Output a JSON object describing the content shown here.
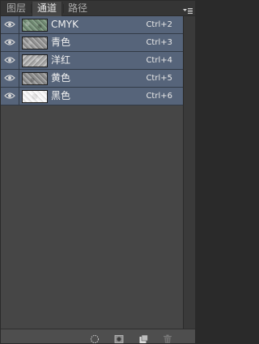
{
  "tabs": [
    {
      "label": "图层",
      "active": false
    },
    {
      "label": "通道",
      "active": true
    },
    {
      "label": "路径",
      "active": false
    }
  ],
  "panel_menu_icon": "panel-menu-icon",
  "channels": [
    {
      "name": "CMYK",
      "shortcut": "Ctrl+2",
      "visible": true,
      "thumb": "composite"
    },
    {
      "name": "青色",
      "shortcut": "Ctrl+3",
      "visible": true,
      "thumb": "gray"
    },
    {
      "name": "洋红",
      "shortcut": "Ctrl+4",
      "visible": true,
      "thumb": "gray"
    },
    {
      "name": "黄色",
      "shortcut": "Ctrl+5",
      "visible": true,
      "thumb": "gray"
    },
    {
      "name": "黑色",
      "shortcut": "Ctrl+6",
      "visible": true,
      "thumb": "white"
    }
  ],
  "toolbar": {
    "icons": [
      "load-selection-icon",
      "save-selection-icon",
      "new-channel-icon",
      "delete-channel-icon"
    ]
  },
  "colors": {
    "panel_bg": "#464646",
    "row_selected": "#56647a",
    "tab_bar": "#353535"
  }
}
